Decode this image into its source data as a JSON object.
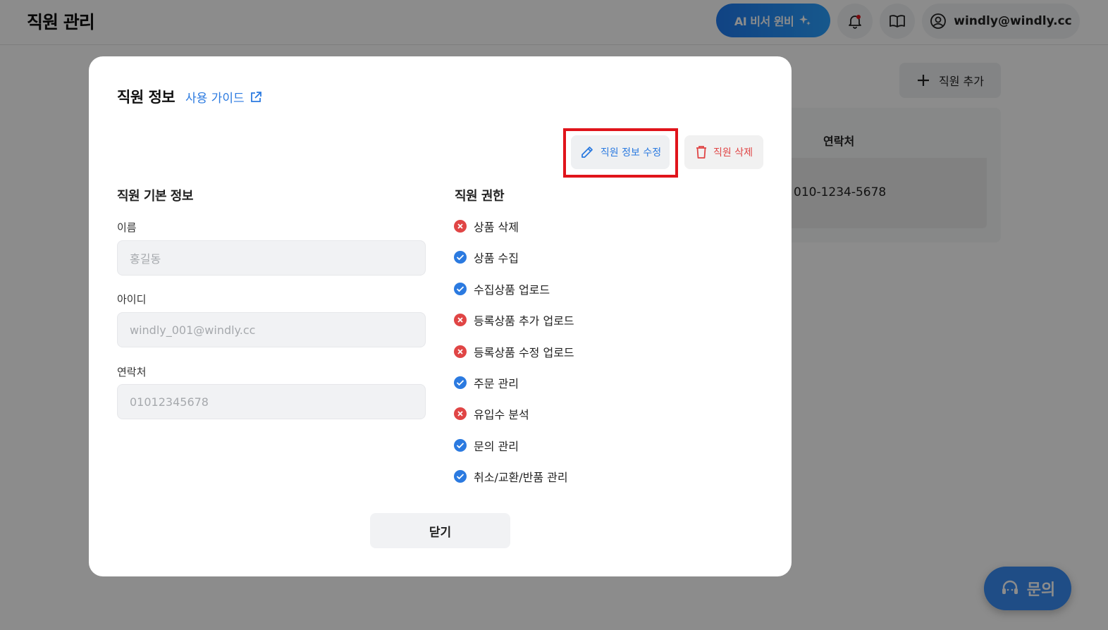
{
  "header": {
    "title": "직원 관리",
    "ai_button_label": "AI 비서 윈비",
    "account_email": "windly@windly.cc"
  },
  "background": {
    "add_staff_label": "직원 추가",
    "column_header": "연락처",
    "row_phone": "010-1234-5678"
  },
  "modal": {
    "title": "직원 정보",
    "guide_link": "사용 가이드",
    "edit_button": "직원 정보 수정",
    "delete_button": "직원 삭제",
    "basic_section_title": "직원 기본 정보",
    "fields": [
      {
        "label": "이름",
        "value": "홍길동"
      },
      {
        "label": "아이디",
        "value": "windly_001@windly.cc"
      },
      {
        "label": "연락처",
        "value": "01012345678"
      }
    ],
    "permission_section_title": "직원 권한",
    "permissions": [
      {
        "label": "상품 삭제",
        "granted": false
      },
      {
        "label": "상품 수집",
        "granted": true
      },
      {
        "label": "수집상품 업로드",
        "granted": true
      },
      {
        "label": "등록상품 추가 업로드",
        "granted": false
      },
      {
        "label": "등록상품 수정 업로드",
        "granted": false
      },
      {
        "label": "주문 관리",
        "granted": true
      },
      {
        "label": "유입수 분석",
        "granted": false
      },
      {
        "label": "문의 관리",
        "granted": true
      },
      {
        "label": "취소/교환/반품 관리",
        "granted": true
      }
    ],
    "close_button": "닫기"
  },
  "floating": {
    "inquiry_label": "문의"
  },
  "colors": {
    "accent": "#2b7ae0",
    "danger": "#e04545",
    "highlight": "#e0141b"
  }
}
